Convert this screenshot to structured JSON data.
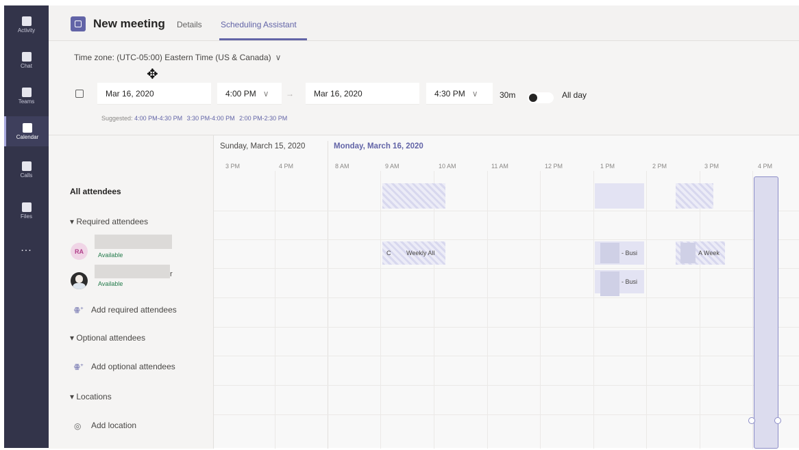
{
  "rail": {
    "items": [
      {
        "label": "Activity",
        "icon": "bell-icon"
      },
      {
        "label": "Chat",
        "icon": "chat-icon"
      },
      {
        "label": "Teams",
        "icon": "teams-icon"
      },
      {
        "label": "Calendar",
        "icon": "calendar-icon"
      },
      {
        "label": "Calls",
        "icon": "phone-icon"
      },
      {
        "label": "Files",
        "icon": "file-icon"
      }
    ],
    "more": "..."
  },
  "header": {
    "title": "New meeting",
    "tabs": [
      {
        "label": "Details"
      },
      {
        "label": "Scheduling Assistant"
      }
    ],
    "active_tab": "Scheduling Assistant"
  },
  "timezone": {
    "label": "Time zone: (UTC-05:00) Eastern Time (US & Canada)",
    "chevron": "∨"
  },
  "form": {
    "start_date": "Mar 16, 2020",
    "start_time": "4:00 PM",
    "end_date": "Mar 16, 2020",
    "end_time": "4:30 PM",
    "duration": "30m",
    "all_day_label": "All day",
    "all_day_on": false,
    "arrow": "→",
    "chevron": "∨"
  },
  "suggested": {
    "label": "Suggested:",
    "slots": [
      "4:00 PM-4:30 PM",
      "3:30 PM-4:00 PM",
      "2:00 PM-2:30 PM"
    ]
  },
  "grid": {
    "day1": "Sunday, March 15, 2020",
    "day2": "Monday, March 16, 2020",
    "hours_day1": [
      "3 PM",
      "4 PM"
    ],
    "hours_day2": [
      "8 AM",
      "9 AM",
      "10 AM",
      "11 AM",
      "12 PM",
      "1 PM",
      "2 PM",
      "3 PM",
      "4 PM"
    ]
  },
  "attendees": {
    "all_label": "All attendees",
    "required_label": "Required attendees",
    "optional_label": "Optional attendees",
    "locations_label": "Locations",
    "add_required": "Add required attendees",
    "add_optional": "Add optional attendees",
    "add_location": "Add location",
    "people": [
      {
        "initials": "RA",
        "status": "Available"
      },
      {
        "name_tail": "r",
        "status": "Available"
      }
    ]
  },
  "events": {
    "ra_1": "C",
    "ra_2": "Weekly All",
    "ra_3": "- Busi",
    "ra_4": "A Week",
    "p2_1": "- Busi"
  },
  "colors": {
    "accent": "#6264a7",
    "rail": "#33344a",
    "available": "#237b4b"
  }
}
